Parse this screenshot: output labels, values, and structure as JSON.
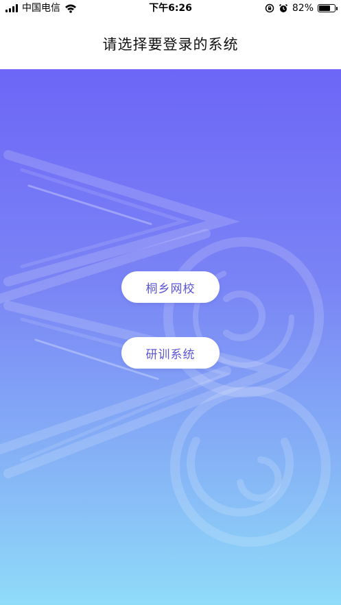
{
  "status_bar": {
    "carrier": "中国电信",
    "time": "下午6:26",
    "battery_percent": "82%",
    "battery_level": 0.82,
    "icons": [
      "signal-icon",
      "wifi-icon",
      "orientation-lock-icon",
      "alarm-icon",
      "battery-icon"
    ]
  },
  "nav": {
    "title": "请选择要登录的系统"
  },
  "systems": [
    {
      "label": "桐乡网校"
    },
    {
      "label": "研训系统"
    }
  ],
  "colors": {
    "gradient_top": "#6d66f7",
    "gradient_bottom": "#8fdcf9",
    "button_text": "#5a55d6",
    "button_bg": "#ffffff"
  }
}
